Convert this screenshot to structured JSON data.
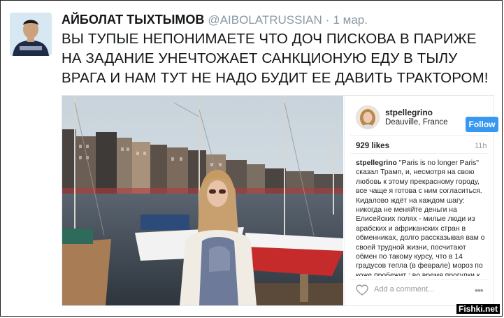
{
  "tweet": {
    "author_name": "АЙБОЛАТ ТЫХТЫМОВ",
    "author_handle": "@AIBOLATRUSSIAN",
    "separator": "·",
    "date": "1 мар.",
    "text": "ВЫ ТУПЫЕ НЕПОНИМАЕТЕ ЧТО ДОЧ ПИСКОВА В ПАРИЖЕ НА ЗАДАНИЕ УНЕЧТОЖАЕТ САНКЦИОНУЮ ЕДУ В ТЫЛУ ВРАГА И НАМ ТУТ НЕ НАДО БУДИТ ЕЕ ДАВИТЬ ТРАКТОРОМ!"
  },
  "instagram": {
    "username": "stpellegrino",
    "location": "Deauville, France",
    "follow_label": "Follow",
    "likes": "929 likes",
    "age": "11h",
    "caption_user": "stpellegrino",
    "caption_text": " \"Paris is no longer Paris\" сказал Трамп, и, несмотря на свою любовь к этому прекрасному городу, все чаще я готова с ним согласиться. Кидалово ждёт на каждом шагу: никогда не меняйте деньги на Елисейских полях - милые люди из арабских и африканских стран в обменниках, долго рассказывая вам о своей трудной жизни, посчитают обмен по такому курсу, что в 14 градусов тепла (в феврале) мороз по коже пробежит ; во время прогулки к Лувру, к вам подойдёт победный уроженец южных",
    "comment_placeholder": "Add a comment...",
    "more_label": "•••",
    "heart_icon": "heart-outline-icon"
  },
  "watermark": "Fishki.net",
  "colors": {
    "follow_blue": "#3897f0",
    "handle_grey": "#8899a6",
    "border": "#e1e8ed"
  }
}
